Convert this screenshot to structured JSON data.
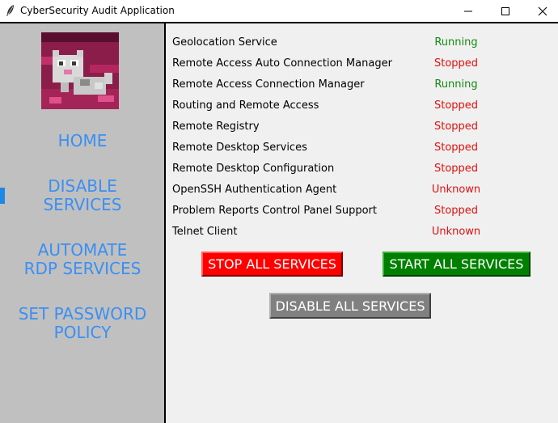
{
  "window": {
    "title": "CyberSecurity Audit Application",
    "icon": "feather-icon"
  },
  "sidebar": {
    "avatar": "pixel-art-cat-avatar",
    "items": [
      {
        "lines": [
          "HOME"
        ]
      },
      {
        "lines": [
          "DISABLE",
          "SERVICES"
        ],
        "active": true
      },
      {
        "lines": [
          "AUTOMATE",
          "RDP SERVICES"
        ]
      },
      {
        "lines": [
          "SET PASSWORD",
          "POLICY"
        ]
      }
    ],
    "color": "#3b8ff2"
  },
  "services": [
    {
      "name": "Geolocation Service",
      "status": "Running"
    },
    {
      "name": "Remote Access Auto Connection Manager",
      "status": "Stopped"
    },
    {
      "name": "Remote Access Connection Manager",
      "status": "Running"
    },
    {
      "name": "Routing and Remote Access",
      "status": "Stopped"
    },
    {
      "name": "Remote Registry",
      "status": "Stopped"
    },
    {
      "name": "Remote Desktop Services",
      "status": "Stopped"
    },
    {
      "name": "Remote Desktop Configuration",
      "status": "Stopped"
    },
    {
      "name": "OpenSSH Authentication Agent",
      "status": "Unknown"
    },
    {
      "name": "Problem Reports Control Panel Support",
      "status": "Stopped"
    },
    {
      "name": "Telnet Client",
      "status": "Unknown"
    }
  ],
  "status_colors": {
    "Running": "#138a13",
    "Stopped": "#e01010",
    "Unknown": "#e01010"
  },
  "buttons": {
    "stop_all": "STOP ALL SERVICES",
    "start_all": "START ALL SERVICES",
    "disable_all": "DISABLE ALL SERVICES"
  }
}
